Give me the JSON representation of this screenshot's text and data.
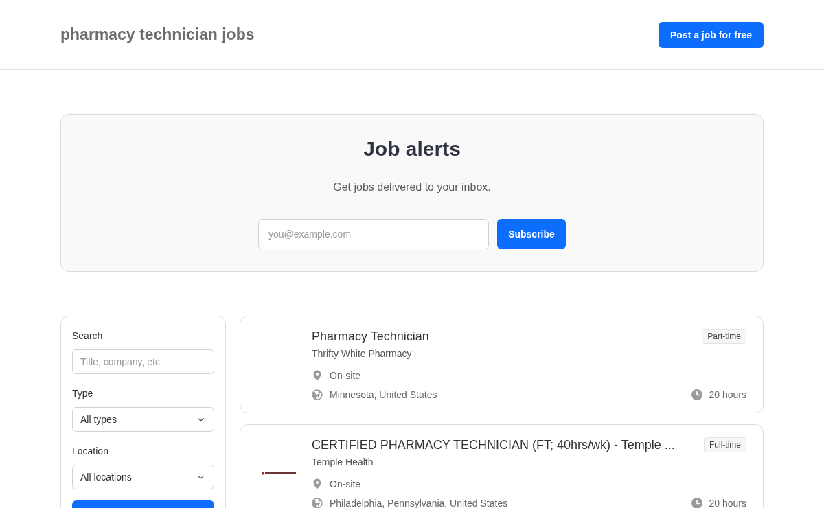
{
  "header": {
    "title": "pharmacy technician jobs",
    "post_button": "Post a job for free"
  },
  "job_alerts": {
    "title": "Job alerts",
    "subtitle": "Get jobs delivered to your inbox.",
    "email_field": {
      "placeholder": "you@example.com"
    },
    "subscribe_button": "Subscribe"
  },
  "filters": {
    "search": {
      "label": "Search",
      "placeholder": "Title, company, etc."
    },
    "type": {
      "label": "Type",
      "value": "All types"
    },
    "location": {
      "label": "Location",
      "value": "All locations"
    }
  },
  "jobs": [
    {
      "title": "Pharmacy Technician",
      "company": "Thrifty White Pharmacy",
      "logo": false,
      "employment_type": "Part-time",
      "workplace": "On-site",
      "location": "Minnesota, United States",
      "hours": "20 hours"
    },
    {
      "title": "CERTIFIED PHARMACY TECHNICIAN (FT; 40hrs/wk) - Temple ...",
      "company": "Temple Health",
      "logo": true,
      "employment_type": "Full-time",
      "workplace": "On-site",
      "location": "Philadelphia, Pennsylvania, United States",
      "hours": "20 hours"
    }
  ]
}
